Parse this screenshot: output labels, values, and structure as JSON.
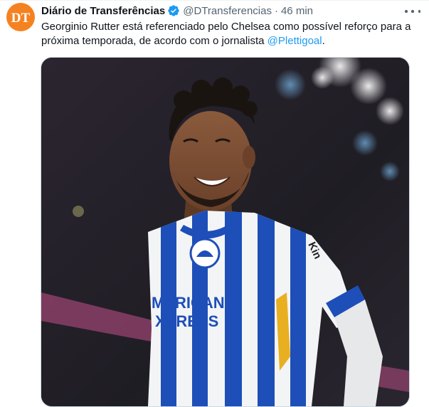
{
  "tweet": {
    "author_name": "Diário de Transferências",
    "handle": "@DTransferencias",
    "separator": "·",
    "time": "46 min",
    "text_before": "Georginio Rutter está referenciado pelo Chelsea como possível reforço para a próxima temporada, de acordo com o jornalista ",
    "mention": "@Plettigoal",
    "text_after": ".",
    "avatar_initials": "DT",
    "media": {
      "sponsor_line1": "MERICAN",
      "sponsor_line2": "XPRESS",
      "sleeve_text": "Kin"
    }
  },
  "icons": {
    "avatar": "dt-logo-icon",
    "verified": "verified-badge-icon",
    "more": "more-options-icon"
  },
  "colors": {
    "accent": "#1d9bf0",
    "avatar_bg": "#f58220",
    "muted_text": "#536471",
    "kit_blue": "#1e4fb8"
  }
}
